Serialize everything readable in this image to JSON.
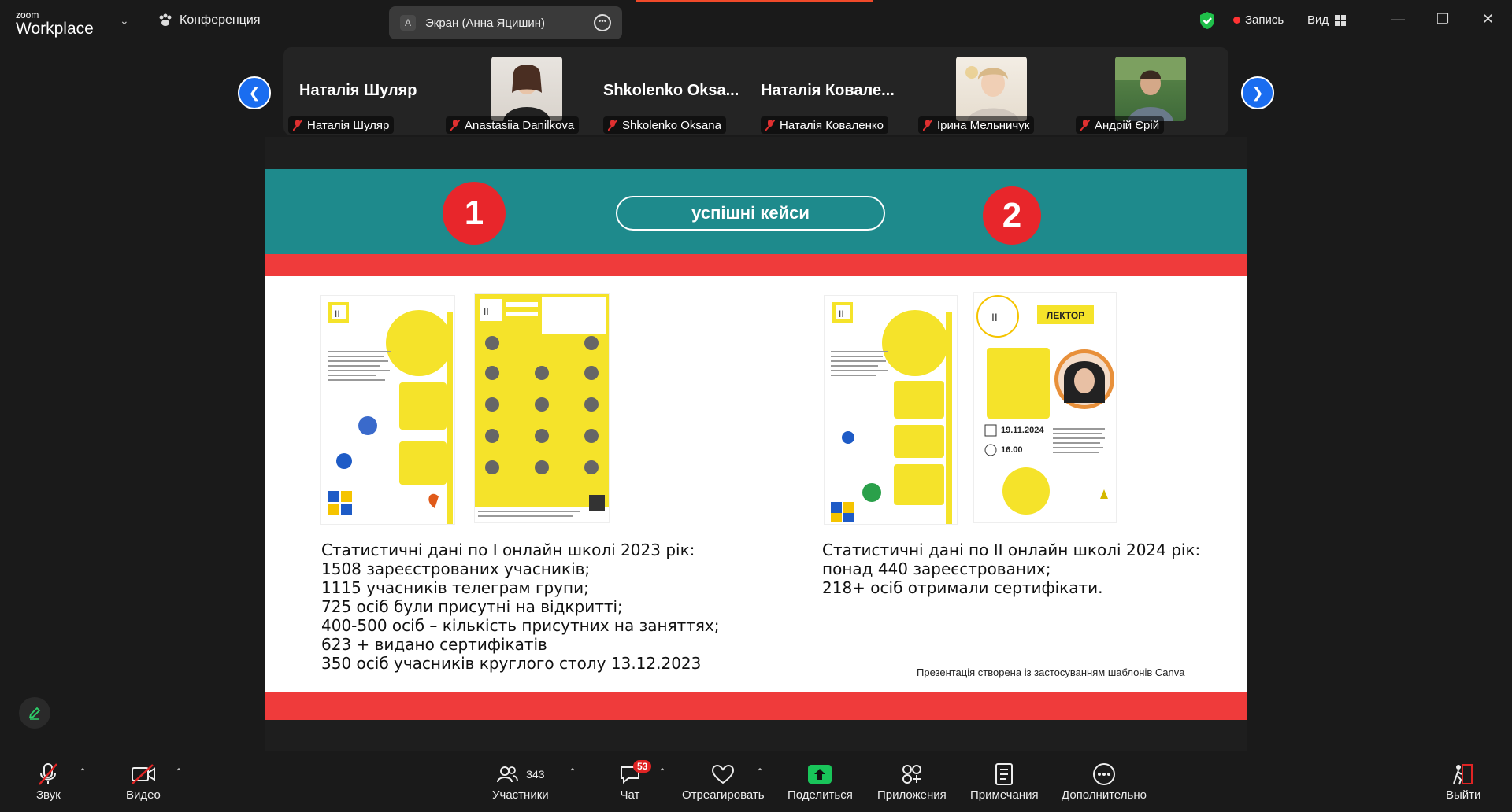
{
  "app": {
    "brand_small": "zoom",
    "brand_big": "Workplace"
  },
  "topbar": {
    "conference_label": "Конференция",
    "screen_avatar": "A",
    "screen_share_label": "Экран (Анна Яцишин)",
    "record_label": "Запись",
    "view_label": "Вид"
  },
  "participants": [
    {
      "name_big": "Наталія Шуляр",
      "label": "Наталія Шуляр",
      "has_photo": false
    },
    {
      "name_big": "",
      "label": "Anastasiia Danilkova",
      "has_photo": true
    },
    {
      "name_big": "Shkolenko  Oksa...",
      "label": "Shkolenko Oksana",
      "has_photo": false
    },
    {
      "name_big": "Наталія  Ковале...",
      "label": "Наталія Коваленко",
      "has_photo": false
    },
    {
      "name_big": "",
      "label": "Ірина Мельничук",
      "has_photo": true
    },
    {
      "name_big": "",
      "label": "Андрій Єрій",
      "has_photo": true
    }
  ],
  "slide": {
    "num1": "1",
    "num2": "2",
    "title": "успішні кейси",
    "poster_lector": "ЛЕКТОР",
    "poster_date": "19.11.2024",
    "poster_time": "16.00",
    "stats_left": [
      "Статистичні дані по I онлайн школі 2023 рік:",
      "1508 зареєстрованих учасників;",
      "1115 учасників телеграм групи;",
      "725 осіб були присутні на відкритті;",
      "400-500 осіб – кількість присутних на заняттях;",
      "623 + видано сертифікатів",
      "350 осіб учасників круглого столу 13.12.2023"
    ],
    "stats_right": [
      "Статистичні дані по II онлайн школі 2024 рік:",
      " понад 440  зареєстрованих;",
      " 218+ осіб отримали сертифікати."
    ],
    "credit": "Презентація створена  із застосуванням шаблонів  Canva"
  },
  "toolbar": {
    "audio_label": "Звук",
    "video_label": "Видео",
    "participants_label": "Участники",
    "participants_count": "343",
    "chat_label": "Чат",
    "chat_badge": "53",
    "react_label": "Отреагировать",
    "share_label": "Поделиться",
    "apps_label": "Приложения",
    "notes_label": "Примечания",
    "more_label": "Дополнительно",
    "leave_label": "Выйти"
  },
  "colors": {
    "accent_blue": "#1a6df0",
    "teal": "#1e8a8c",
    "red": "#ef3b3b",
    "share_green": "#19c55a",
    "poster_yellow": "#f5e32a"
  }
}
